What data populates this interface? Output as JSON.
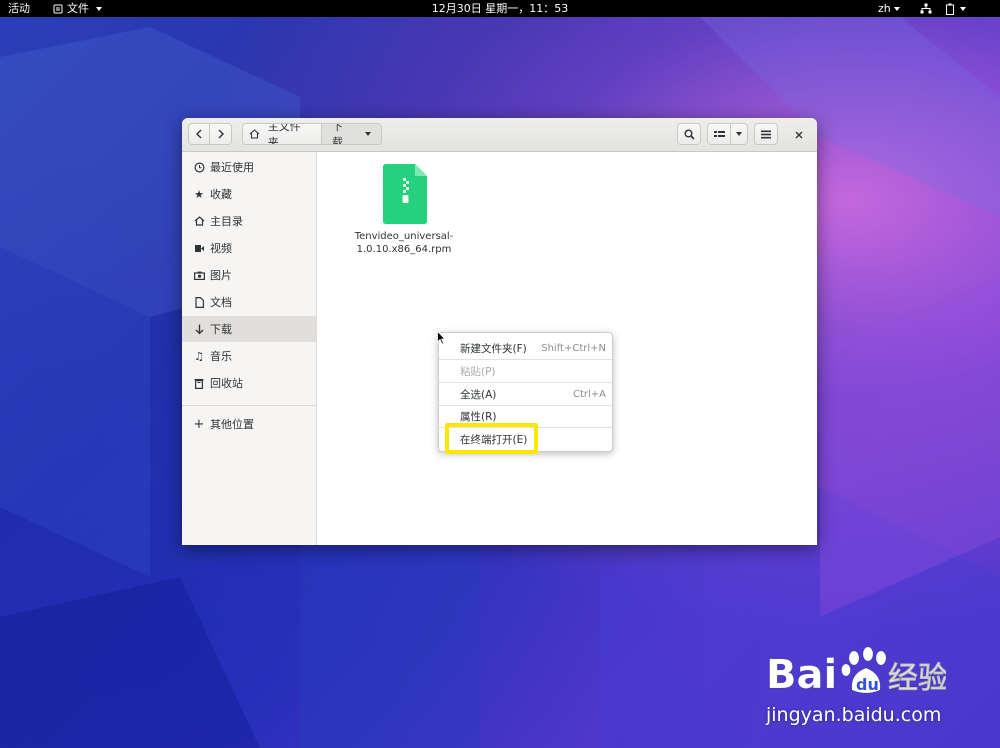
{
  "topbar": {
    "activities": "活动",
    "app_menu": "文件",
    "clock": "12月30日 星期一，11：53",
    "lang": "zh"
  },
  "window": {
    "path": {
      "home_label": "主文件夹",
      "current_label": "下载"
    }
  },
  "sidebar": {
    "items": [
      {
        "label": "最近使用",
        "icon": "clock-icon"
      },
      {
        "label": "收藏",
        "icon": "star-icon"
      },
      {
        "label": "主目录",
        "icon": "home-icon"
      },
      {
        "label": "视频",
        "icon": "video-icon"
      },
      {
        "label": "图片",
        "icon": "camera-icon"
      },
      {
        "label": "文档",
        "icon": "document-icon"
      },
      {
        "label": "下载",
        "icon": "download-arrow-icon"
      },
      {
        "label": "音乐",
        "icon": "music-note-icon"
      },
      {
        "label": "回收站",
        "icon": "trash-icon"
      }
    ],
    "other_places": "其他位置",
    "active_index": 6
  },
  "files": [
    {
      "name_line1": "Tenvideo_universal-",
      "name_line2": "1.0.10.x86_64.rpm",
      "icon": "archive-file-icon",
      "color": "#26d07c"
    }
  ],
  "context_menu": {
    "items": [
      {
        "label": "新建文件夹(F)",
        "shortcut": "Shift+Ctrl+N",
        "enabled": true
      },
      {
        "label": "粘贴(P)",
        "shortcut": "",
        "enabled": false
      },
      {
        "label": "全选(A)",
        "shortcut": "Ctrl+A",
        "enabled": true
      },
      {
        "label": "属性(R)",
        "shortcut": "",
        "enabled": true
      },
      {
        "label": "在终端打开(E)",
        "shortcut": "",
        "enabled": true
      }
    ],
    "highlight_color": "#ffe800"
  },
  "watermark": {
    "brand": "Bai du 经验",
    "url": "jingyan.baidu.com"
  }
}
